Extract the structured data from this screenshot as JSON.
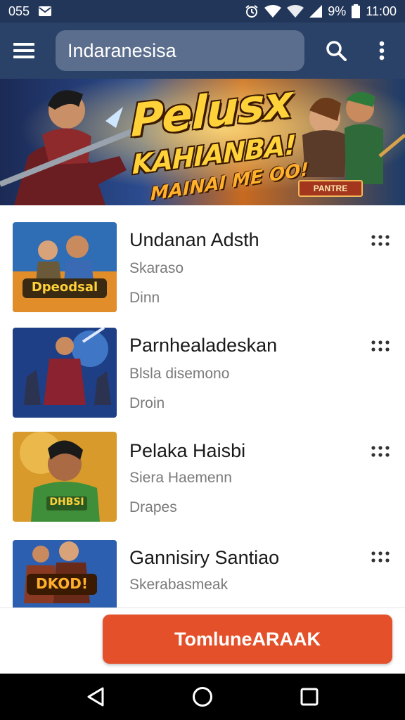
{
  "status_bar": {
    "time": "055",
    "battery_percent": "9%",
    "clock": "11:00",
    "icons": [
      "mail-icon",
      "alarm-icon",
      "wifi-icon",
      "signal-icon",
      "battery-icon"
    ]
  },
  "app_bar": {
    "search_value": "Indaranesisa",
    "icons": [
      "menu-icon",
      "search-icon",
      "more-vert-icon"
    ]
  },
  "banner": {
    "headline": "Pelusx",
    "subheadline": "KAHIANBA!",
    "tagline": "MAINAI ME OO!",
    "badge": "PANTRE"
  },
  "games": [
    {
      "title": "Undanan Adsth",
      "subtitle": "Skarasо",
      "meta": "Dinn",
      "thumb_label": "Dpeodsal",
      "accent": "#e79a2b"
    },
    {
      "title": "Parnhealadeskan",
      "subtitle": "Blsla disemono",
      "meta": "Droin",
      "thumb_label": "",
      "accent": "#3b63b8"
    },
    {
      "title": "Pelaka Haisbi",
      "subtitle": "Siera Haemenn",
      "meta": "Drapes",
      "thumb_label": "DHBSI",
      "accent": "#3f8f3a"
    },
    {
      "title": "Gannisiry Santiao",
      "subtitle": "Skerabasmeak",
      "meta": "",
      "thumb_label": "DKOD!",
      "accent": "#2d5fb0"
    }
  ],
  "cta": {
    "label": "TomluneARAAK",
    "color": "#e4502a"
  },
  "nav_bar": {
    "icons": [
      "back-icon",
      "home-icon",
      "recents-icon"
    ]
  },
  "colors": {
    "status_bar": "#223659",
    "app_bar": "#2a4268",
    "search_box": "#5b6e8d"
  }
}
